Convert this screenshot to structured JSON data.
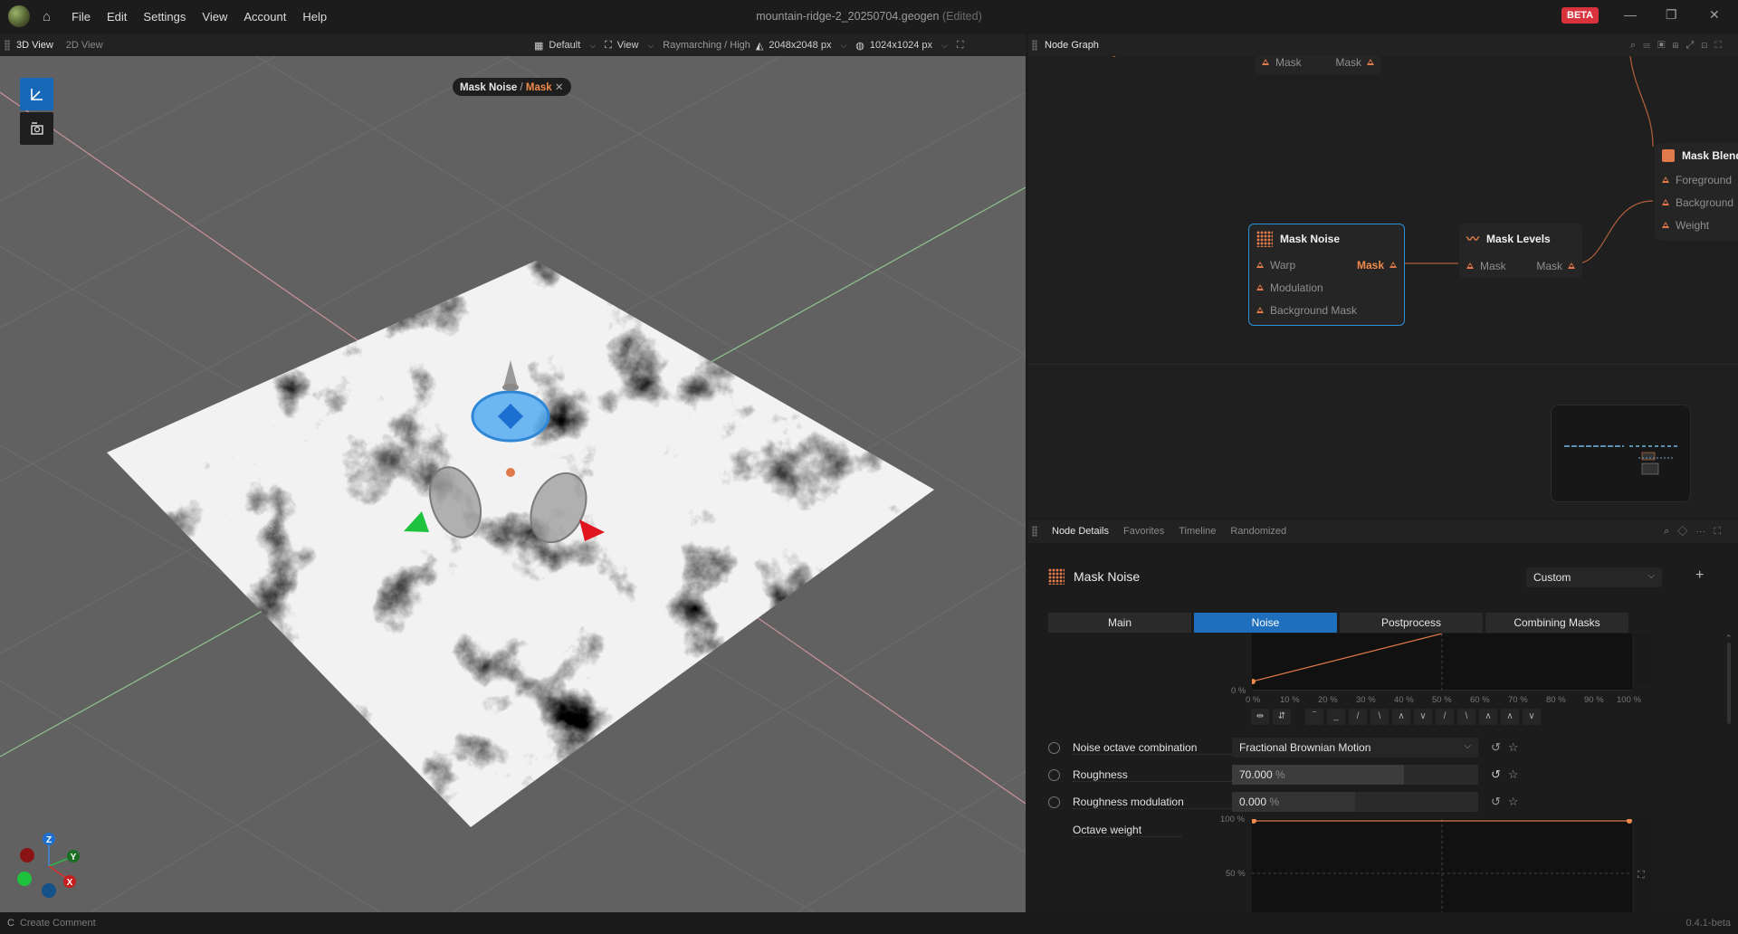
{
  "app": {
    "menu": [
      "File",
      "Edit",
      "Settings",
      "View",
      "Account",
      "Help"
    ],
    "document_title": "mountain-ridge-2_20250704.geogen",
    "edited_tag": "(Edited)",
    "beta_badge": "BETA"
  },
  "viewport_panel": {
    "tabs": [
      "3D View",
      "2D View"
    ],
    "tools": {
      "preset": "Default",
      "view": "View",
      "render_mode": "Raymarching / High",
      "resolution": "2048x2048 px",
      "preview_resolution": "1024x1024 px"
    },
    "breadcrumb": {
      "node": "Mask Noise",
      "separator": "/",
      "output": "Mask"
    },
    "gizmo_axes": {
      "z": "Z",
      "y": "Y",
      "x": "X"
    }
  },
  "node_graph": {
    "title": "Node Graph",
    "nodes": {
      "partial_top": {
        "in": "Mask",
        "out": "Mask"
      },
      "mask_noise": {
        "title": "Mask Noise",
        "ports": [
          "Warp",
          "Modulation",
          "Background Mask"
        ],
        "output": "Mask"
      },
      "mask_levels": {
        "title": "Mask Levels",
        "in": "Mask",
        "out": "Mask"
      },
      "mask_blend": {
        "title": "Mask Blend",
        "ports": [
          "Foreground",
          "Background",
          "Weight"
        ]
      }
    }
  },
  "details": {
    "tabs": [
      "Node Details",
      "Favorites",
      "Timeline",
      "Randomized"
    ],
    "node_title": "Mask Noise",
    "preset": "Custom",
    "section_tabs": [
      "Main",
      "Noise",
      "Postprocess",
      "Combining Masks"
    ],
    "active_section": "Noise",
    "curve_x_ticks": [
      "0 %",
      "10 %",
      "20 %",
      "30 %",
      "40 %",
      "50 %",
      "60 %",
      "70 %",
      "80 %",
      "90 %",
      "100 %"
    ],
    "curve_y_zero": "0 %",
    "params": {
      "octave_combination": {
        "label": "Noise octave combination",
        "value": "Fractional Brownian Motion"
      },
      "roughness": {
        "label": "Roughness",
        "value": "70.000",
        "unit": "%",
        "fraction": 0.7
      },
      "roughness_modulation": {
        "label": "Roughness modulation",
        "value": "0.000",
        "unit": "%",
        "fraction": 0.0
      },
      "octave_weight": {
        "label": "Octave weight",
        "y_top": "100 %",
        "y_mid": "50 %"
      }
    }
  },
  "statusbar": {
    "left": "Create Comment",
    "left_key": "C",
    "version": "0.4.1-beta"
  }
}
